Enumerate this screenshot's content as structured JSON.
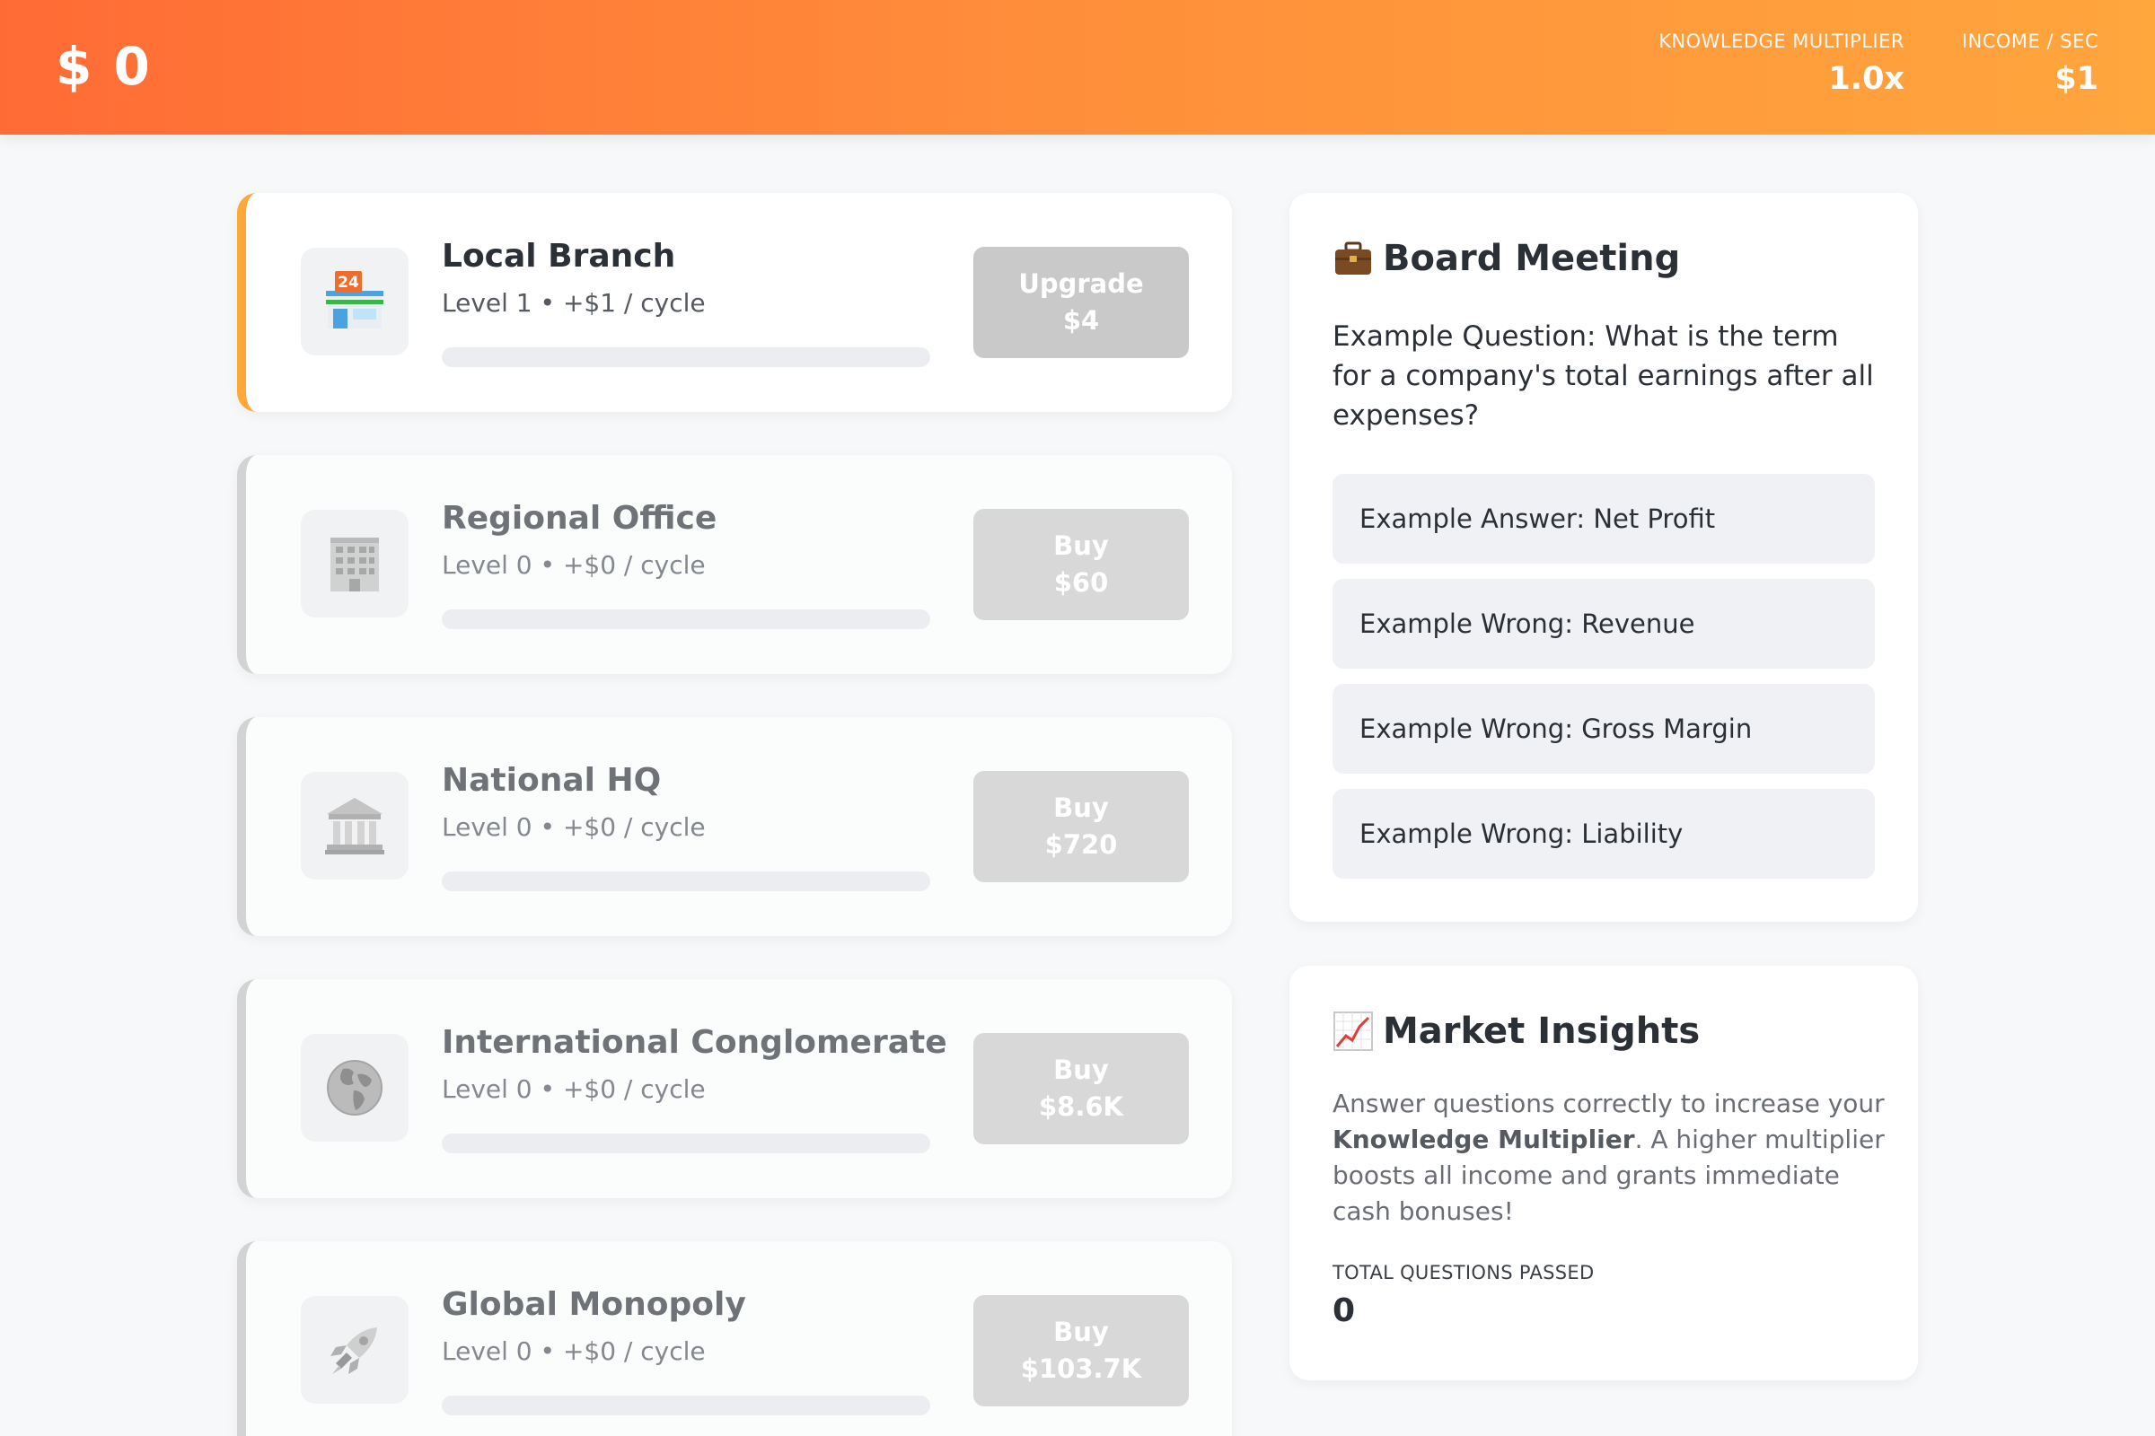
{
  "header": {
    "cash": "$ 0",
    "multiplier_label": "KNOWLEDGE MULTIPLIER",
    "multiplier_value": "1.0x",
    "income_label": "INCOME / SEC",
    "income_value": "$1"
  },
  "businesses": [
    {
      "name": "Local Branch",
      "level_text": "Level 1 • +$1 / cycle",
      "button_action": "Upgrade",
      "button_price": "$4",
      "progress": 0,
      "icon": "convenience-store-icon"
    },
    {
      "name": "Regional Office",
      "level_text": "Level 0 • +$0 / cycle",
      "button_action": "Buy",
      "button_price": "$60",
      "progress": 0,
      "icon": "office-building-icon"
    },
    {
      "name": "National HQ",
      "level_text": "Level 0 • +$0 / cycle",
      "button_action": "Buy",
      "button_price": "$720",
      "progress": 0,
      "icon": "classical-building-icon"
    },
    {
      "name": "International Conglomerate",
      "level_text": "Level 0 • +$0 / cycle",
      "button_action": "Buy",
      "button_price": "$8.6K",
      "progress": 0,
      "icon": "globe-icon"
    },
    {
      "name": "Global Monopoly",
      "level_text": "Level 0 • +$0 / cycle",
      "button_action": "Buy",
      "button_price": "$103.7K",
      "progress": 0,
      "icon": "rocket-icon"
    }
  ],
  "board": {
    "icon": "briefcase-icon",
    "title": "Board Meeting",
    "question": "Example Question: What is the term for a company's total earnings after all expenses?",
    "answers": [
      "Example Answer: Net Profit",
      "Example Wrong: Revenue",
      "Example Wrong: Gross Margin",
      "Example Wrong: Liability"
    ]
  },
  "insights": {
    "icon": "chart-increasing-icon",
    "title": "Market Insights",
    "text_before": "Answer questions correctly to increase your ",
    "text_bold": "Knowledge Multiplier",
    "text_after": ". A higher multiplier boosts all income and grants immediate cash bonuses!",
    "passed_label": "TOTAL QUESTIONS PASSED",
    "passed_value": "0"
  },
  "colors": {
    "header_gradient_start": "#ff6b35",
    "header_gradient_end": "#ffa63d",
    "owned_accent": "#ffa83a",
    "disabled_button": "#c9c9c9"
  }
}
